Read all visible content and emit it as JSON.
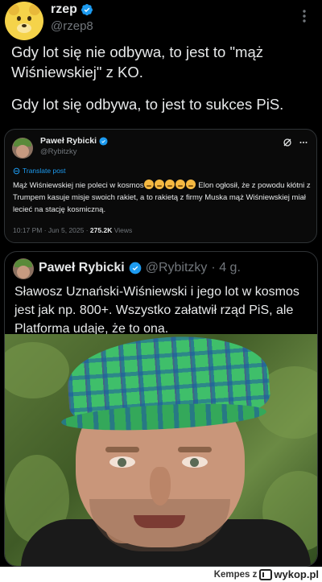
{
  "tweet": {
    "author_name": "rzep",
    "author_handle": "@rzep8",
    "text_line1": "Gdy lot się nie odbywa, to jest to \"mąż Wiśniewskiej\" z KO.",
    "text_line2": "Gdy lot się odbywa, to jest to sukces PiS.",
    "more_icon": "more-icon"
  },
  "quote": {
    "author_name": "Paweł Rybicki",
    "author_handle": "@Rybitzky",
    "translate_label": "Translate post",
    "text_part1": "Mąż Wiśniewskiej nie poleci w kosmos",
    "text_part2": " Elon ogłosił, że z powodu kłótni z Trumpem kasuje misje swoich rakiet, a to rakietą z firmy Muska mąż Wiśniewskiej miał lecieć na stację kosmiczną.",
    "emoji_count": 5,
    "timestamp": "10:17 PM · Jun 5, 2025 · ",
    "views_count": "275.2K",
    "views_label": " Views"
  },
  "embedded": {
    "author_name": "Paweł Rybicki",
    "author_handle": "@Rybitzky",
    "time": "· 4 g.",
    "text": "Sławosz Uznański-Wiśniewski i jego lot w kosmos jest jak np. 800+. Wszystko załatwił rząd PiS, ale Platforma udaje, że to ona."
  },
  "watermark": {
    "label": "Kempes z",
    "site": "wykop.pl"
  },
  "colors": {
    "background": "#000000",
    "text": "#e7e9ea",
    "secondary": "#71767b",
    "link": "#1d9bf0",
    "verified": "#1d9bf0",
    "border": "#2f3336"
  }
}
